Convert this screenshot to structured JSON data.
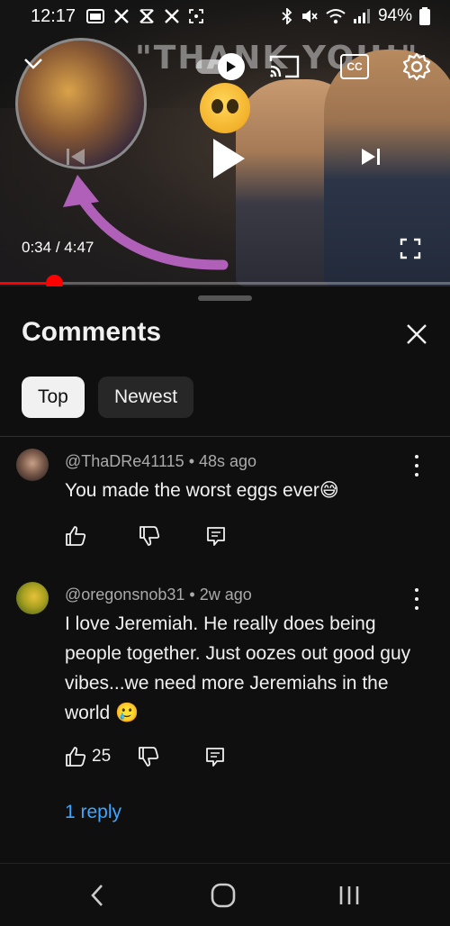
{
  "status_bar": {
    "time": "12:17",
    "notif_icons": [
      "gallery-icon",
      "x-icon",
      "x-icon",
      "x-icon",
      "screenshot-icon"
    ],
    "battery": "94%"
  },
  "video": {
    "sign_text": "\"THANK YOU!\"",
    "current_time": "0:34",
    "duration": "4:47",
    "time_separator": " / ",
    "progress_fraction": 0.12,
    "autoplay_on": true,
    "cc_label": "CC",
    "accent_color": "#ff0000"
  },
  "comments_panel": {
    "title": "Comments",
    "filters": [
      {
        "label": "Top",
        "selected": true
      },
      {
        "label": "Newest",
        "selected": false
      }
    ],
    "items": [
      {
        "username": "@ThaDRe41115",
        "separator": " • ",
        "age": "48s ago",
        "text": "You made the worst eggs ever😅",
        "likes": ""
      },
      {
        "username": "@oregonsnob31",
        "separator": " • ",
        "age": "2w ago",
        "text": "I love Jeremiah. He really does being people together. Just oozes out good guy vibes...we need more Jeremiahs in the world 🥲",
        "likes": "25",
        "replies_label": "1 reply"
      }
    ]
  },
  "colors": {
    "background": "#0f0f0f",
    "link": "#3ea6ff",
    "chip_selected": "#f1f1f1",
    "chip_unselected": "#272727"
  }
}
